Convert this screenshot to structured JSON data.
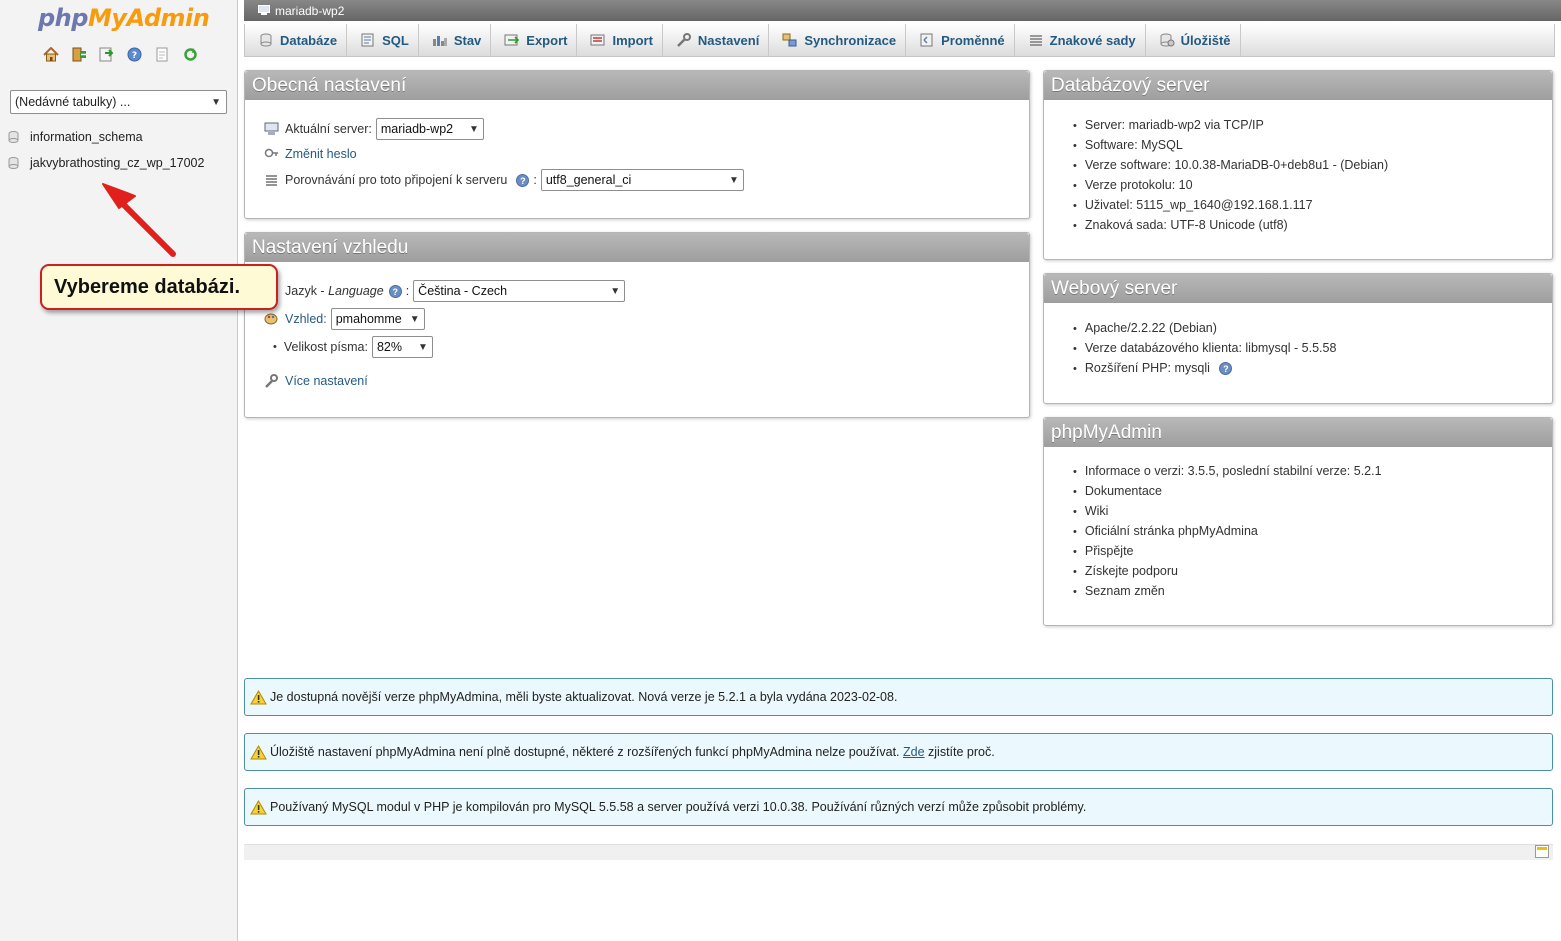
{
  "nav": {
    "logo_php": "php",
    "logo_myadmin": "MyAdmin",
    "icons": [
      "home-icon",
      "logout-icon",
      "query-window-icon",
      "help-icon",
      "docs-icon",
      "reload-icon"
    ],
    "recent_select": "(Nedávné tabulky) ...",
    "databases": [
      "information_schema",
      "jakvybrathosting_cz_wp_17002"
    ]
  },
  "topbar": {
    "server": "mariadb-wp2"
  },
  "tabs": [
    {
      "label": "Databáze",
      "icon": "database-icon"
    },
    {
      "label": "SQL",
      "icon": "sql-icon"
    },
    {
      "label": "Stav",
      "icon": "status-icon"
    },
    {
      "label": "Export",
      "icon": "export-icon"
    },
    {
      "label": "Import",
      "icon": "import-icon"
    },
    {
      "label": "Nastavení",
      "icon": "wrench-icon"
    },
    {
      "label": "Synchronizace",
      "icon": "sync-icon"
    },
    {
      "label": "Proměnné",
      "icon": "variables-icon"
    },
    {
      "label": "Znakové sady",
      "icon": "charset-icon"
    },
    {
      "label": "Úložiště",
      "icon": "storage-icon"
    }
  ],
  "general": {
    "title": "Obecná nastavení",
    "server_label": "Aktuální server:",
    "server_value": "mariadb-wp2",
    "change_password": "Změnit heslo",
    "collation_label": "Porovnávání pro toto připojení k serveru",
    "collation_sep": ":",
    "collation_value": "utf8_general_ci"
  },
  "appearance": {
    "title": "Nastavení vzhledu",
    "language_label": "Jazyk",
    "language_sep": " - ",
    "language_label_en": "Language",
    "language_colon": ":",
    "language_value": "Čeština - Czech",
    "theme_label": "Vzhled:",
    "theme_value": "pmahomme",
    "font_size_label": "Velikost písma:",
    "font_size_value": "82%",
    "more_settings": "Více nastavení"
  },
  "db_server": {
    "title": "Databázový server",
    "items": [
      "Server: mariadb-wp2 via TCP/IP",
      "Software: MySQL",
      "Verze software: 10.0.38-MariaDB-0+deb8u1 - (Debian)",
      "Verze protokolu: 10",
      "Uživatel: 5115_wp_1640@192.168.1.117",
      "Znaková sada: UTF-8 Unicode (utf8)"
    ]
  },
  "web_server": {
    "title": "Webový server",
    "items": [
      "Apache/2.2.22 (Debian)",
      "Verze databázového klienta: libmysql - 5.5.58",
      "Rozšíření PHP: mysqli"
    ]
  },
  "pma": {
    "title": "phpMyAdmin",
    "version_info": "Informace o verzi: 3.5.5, poslední stabilní verze: 5.2.1",
    "links": [
      "Dokumentace",
      "Wiki",
      "Oficiální stránka phpMyAdmina",
      "Přispějte",
      "Získejte podporu",
      "Seznam změn"
    ]
  },
  "notices": {
    "n1": "Je dostupná novější verze phpMyAdmina, měli byste aktualizovat. Nová verze je 5.2.1 a byla vydána 2023-02-08.",
    "n2_before": "Úložiště nastavení phpMyAdmina není plně dostupné, některé z rozšířených funkcí phpMyAdmina nelze používat. ",
    "n2_link": "Zde",
    "n2_after": " zjistíte proč.",
    "n3": "Používaný MySQL modul v PHP je kompilován pro MySQL 5.5.58 a server používá verzi 10.0.38. Používání různých verzí může způsobit problémy."
  },
  "annotation": {
    "text": "Vybereme databázi."
  },
  "colors": {
    "link": "#235a81",
    "panel_header": "#a8a8a8",
    "notice_bg": "#ebf8fd",
    "callout_border": "#cc1f1f",
    "arrow": "#e0201c"
  }
}
